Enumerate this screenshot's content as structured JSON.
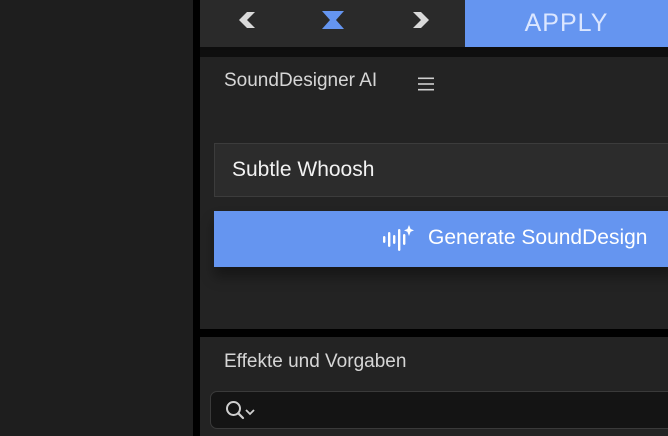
{
  "toolbar": {
    "apply_label": "APPLY",
    "prev_icon": "chevron-left-double-icon",
    "mid_icon": "hourglass-icon",
    "next_icon": "chevron-right-icon"
  },
  "sound_designer": {
    "title": "SoundDesigner AI",
    "menu_icon": "hamburger-menu-icon",
    "preset_value": "Subtle Whoosh",
    "generate_label": "Generate SoundDesign",
    "generate_icon": "ai-waveform-sparkle-icon"
  },
  "effects": {
    "title": "Effekte und Vorgaben",
    "search_icon": "search-icon",
    "search_value": ""
  },
  "colors": {
    "accent": "#6595f0",
    "panel_bg": "#232323",
    "app_bg": "#1e1e1e"
  }
}
